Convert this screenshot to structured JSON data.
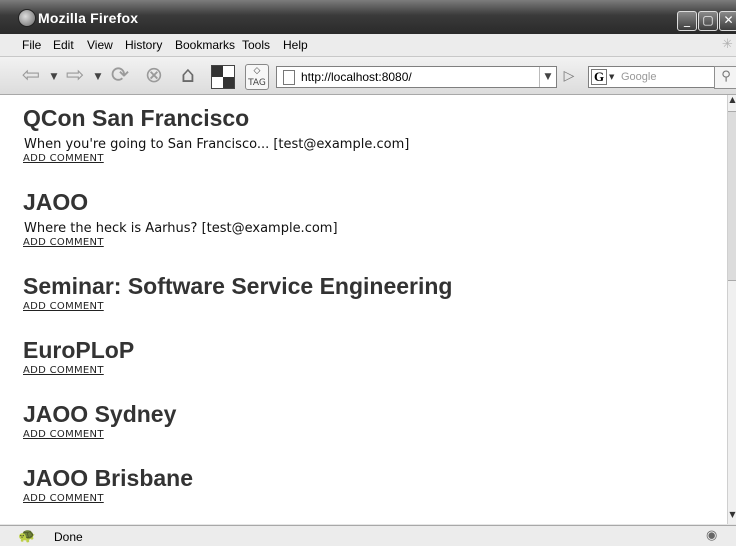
{
  "window": {
    "title": "Mozilla Firefox"
  },
  "menu": [
    "File",
    "Edit",
    "View",
    "History",
    "Bookmarks",
    "Tools",
    "Help"
  ],
  "toolbar": {
    "url": "http://localhost:8080/",
    "search_placeholder": "Google",
    "search_engine_letter": "G",
    "tag_label": "TAG"
  },
  "entries": [
    {
      "title": "QCon San Francisco",
      "description": "When you're going to San Francisco... [test@example.com]",
      "link": "ADD COMMENT"
    },
    {
      "title": "JAOO",
      "description": "Where the heck is Aarhus? [test@example.com]",
      "link": "ADD COMMENT"
    },
    {
      "title": "Seminar: Software Service Engineering",
      "description": "",
      "link": "ADD COMMENT"
    },
    {
      "title": "EuroPLoP",
      "description": "",
      "link": "ADD COMMENT"
    },
    {
      "title": "JAOO Sydney",
      "description": "",
      "link": "ADD COMMENT"
    },
    {
      "title": "JAOO Brisbane",
      "description": "",
      "link": "ADD COMMENT"
    }
  ],
  "status": {
    "text": "Done"
  },
  "icons": {
    "firefox": "firefox-logo-icon",
    "back": "back-arrow-icon",
    "forward": "forward-arrow-icon",
    "reload": "reload-icon",
    "stop": "stop-icon",
    "home": "home-icon",
    "bookmarks": "bookmark-grid-icon",
    "tag": "tag-icon",
    "go": "go-arrow-icon",
    "search": "magnifier-icon",
    "throbber": "throbber-icon"
  }
}
